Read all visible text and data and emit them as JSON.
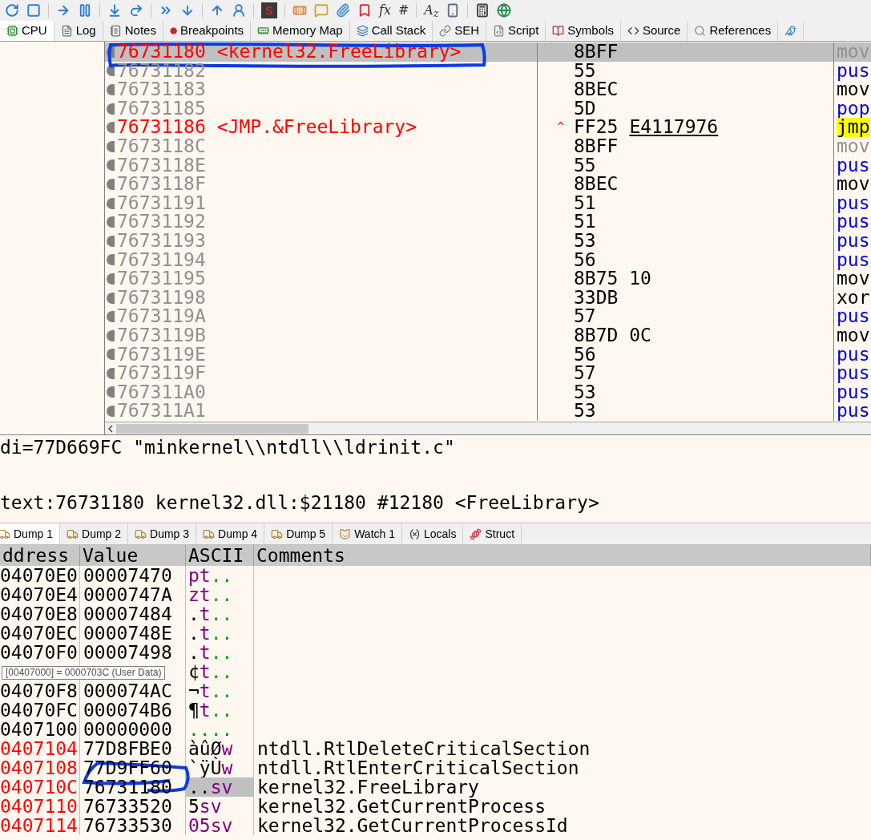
{
  "toolbar": [
    {
      "kind": "icon"
    },
    {
      "kind": "icon"
    },
    {
      "kind": "separator"
    },
    {
      "kind": "icon"
    },
    {
      "kind": "icon"
    },
    {
      "kind": "separator"
    },
    {
      "kind": "icon"
    },
    {
      "kind": "icon"
    },
    {
      "kind": "separator"
    },
    {
      "kind": "icon"
    },
    {
      "kind": "icon"
    },
    {
      "kind": "separator"
    },
    {
      "kind": "icon"
    },
    {
      "kind": "icon"
    },
    {
      "kind": "separator"
    },
    {
      "kind": "badge",
      "text": "S"
    },
    {
      "kind": "separator"
    },
    {
      "kind": "icon"
    },
    {
      "kind": "icon"
    },
    {
      "kind": "icon"
    },
    {
      "kind": "icon"
    },
    {
      "kind": "text",
      "text": "fx"
    },
    {
      "kind": "text",
      "text": "#"
    },
    {
      "kind": "separator"
    },
    {
      "kind": "text",
      "text": "A$_{z}$"
    },
    {
      "kind": "icon"
    },
    {
      "kind": "separator"
    },
    {
      "kind": "icon"
    },
    {
      "kind": "icon"
    }
  ],
  "tabs": [
    {
      "label": "CPU",
      "selected": true
    },
    {
      "label": "Log",
      "selected": false
    },
    {
      "label": "Notes",
      "selected": false
    },
    {
      "label": "Breakpoints",
      "selected": false
    },
    {
      "label": "Memory Map",
      "selected": false
    },
    {
      "label": "Call Stack",
      "selected": false
    },
    {
      "label": "SEH",
      "selected": false
    },
    {
      "label": "Script",
      "selected": false
    },
    {
      "label": "Symbols",
      "selected": false
    },
    {
      "label": "Source",
      "selected": false
    },
    {
      "label": "References",
      "selected": false
    },
    {
      "selected": false
    }
  ],
  "disassembly": {
    "rows": [
      {
        "address": "76731180",
        "label": "<kernel32.FreeLibrary>",
        "kind": "label",
        "selected": true,
        "bytes": "8BFF",
        "mnemonic": {
          "text": "mov",
          "kind": "nop"
        }
      },
      {
        "address": "76731182",
        "kind": "plain",
        "selected": false,
        "bytes": "55",
        "mnemonic": {
          "text": "pus",
          "kind": "stack"
        }
      },
      {
        "address": "76731183",
        "kind": "plain",
        "selected": false,
        "bytes": "8BEC",
        "mnemonic": {
          "text": "mov",
          "kind": "normal"
        }
      },
      {
        "address": "76731185",
        "kind": "plain",
        "selected": false,
        "bytes": "5D",
        "mnemonic": {
          "text": "pop",
          "kind": "stack"
        }
      },
      {
        "address": "76731186",
        "label": "<JMP.&FreeLibrary>",
        "kind": "label",
        "selected": false,
        "jump_mark": "^",
        "bytes": "FF25",
        "target": "E4117976",
        "mnemonic": {
          "text": "jmp",
          "kind": "jump"
        }
      },
      {
        "address": "7673118C",
        "kind": "plain",
        "selected": false,
        "bytes": "8BFF",
        "mnemonic": {
          "text": "mov",
          "kind": "nop"
        }
      },
      {
        "address": "7673118E",
        "kind": "plain",
        "selected": false,
        "bytes": "55",
        "mnemonic": {
          "text": "pus",
          "kind": "stack"
        }
      },
      {
        "address": "7673118F",
        "kind": "plain",
        "selected": false,
        "bytes": "8BEC",
        "mnemonic": {
          "text": "mov",
          "kind": "normal"
        }
      },
      {
        "address": "76731191",
        "kind": "plain",
        "selected": false,
        "bytes": "51",
        "mnemonic": {
          "text": "pus",
          "kind": "stack"
        }
      },
      {
        "address": "76731192",
        "kind": "plain",
        "selected": false,
        "bytes": "51",
        "mnemonic": {
          "text": "pus",
          "kind": "stack"
        }
      },
      {
        "address": "76731193",
        "kind": "plain",
        "selected": false,
        "bytes": "53",
        "mnemonic": {
          "text": "pus",
          "kind": "stack"
        }
      },
      {
        "address": "76731194",
        "kind": "plain",
        "selected": false,
        "bytes": "56",
        "mnemonic": {
          "text": "pus",
          "kind": "stack"
        }
      },
      {
        "address": "76731195",
        "kind": "plain",
        "selected": false,
        "bytes": "8B75 10",
        "mnemonic": {
          "text": "mov",
          "kind": "normal"
        }
      },
      {
        "address": "76731198",
        "kind": "plain",
        "selected": false,
        "bytes": "33DB",
        "mnemonic": {
          "text": "xor",
          "kind": "normal"
        }
      },
      {
        "address": "7673119A",
        "kind": "plain",
        "selected": false,
        "bytes": "57",
        "mnemonic": {
          "text": "pus",
          "kind": "stack"
        }
      },
      {
        "address": "7673119B",
        "kind": "plain",
        "selected": false,
        "bytes": "8B7D 0C",
        "mnemonic": {
          "text": "mov",
          "kind": "normal"
        }
      },
      {
        "address": "7673119E",
        "kind": "plain",
        "selected": false,
        "bytes": "56",
        "mnemonic": {
          "text": "pus",
          "kind": "stack"
        }
      },
      {
        "address": "7673119F",
        "kind": "plain",
        "selected": false,
        "bytes": "57",
        "mnemonic": {
          "text": "pus",
          "kind": "stack"
        }
      },
      {
        "address": "767311A0",
        "kind": "plain",
        "selected": false,
        "bytes": "53",
        "mnemonic": {
          "text": "pus",
          "kind": "stack"
        }
      },
      {
        "address": "767311A1",
        "kind": "plain",
        "selected": false,
        "bytes": "53",
        "mnemonic": {
          "text": "pus",
          "kind": "stack"
        }
      }
    ]
  },
  "info": [
    "di=77D669FC \"minkernel\\\\ntdll\\\\ldrinit.c\"",
    "text:76731180 kernel32.dll:$21180 #12180 <FreeLibrary>"
  ],
  "dump_tabs": [
    {
      "label": "Dump 1",
      "selected": true
    },
    {
      "label": "Dump 2",
      "selected": false
    },
    {
      "label": "Dump 3",
      "selected": false
    },
    {
      "label": "Dump 4",
      "selected": false
    },
    {
      "label": "Dump 5",
      "selected": false
    },
    {
      "label": "Watch 1",
      "selected": false
    },
    {
      "label": "Locals",
      "selected": false
    },
    {
      "label": "Struct",
      "selected": false
    }
  ],
  "dump": {
    "columns": [
      "ddress",
      "Value",
      "ASCII",
      "Comments"
    ],
    "rows": [
      {
        "address": "04070E0",
        "kind": "plain",
        "selected": false,
        "value": "00007470",
        "ascii": [
          {
            "text": "pt",
            "kind": "letter"
          },
          {
            "text": "..",
            "kind": "dot"
          }
        ]
      },
      {
        "address": "04070E4",
        "kind": "plain",
        "selected": false,
        "value": "0000747A",
        "ascii": [
          {
            "text": "zt",
            "kind": "letter"
          },
          {
            "text": "..",
            "kind": "dot"
          }
        ]
      },
      {
        "address": "04070E8",
        "kind": "plain",
        "selected": false,
        "value": "00007484",
        "ascii": [
          {
            "text": ".",
            "kind": "plain"
          },
          {
            "text": "t",
            "kind": "letter"
          },
          {
            "text": "..",
            "kind": "dot"
          }
        ]
      },
      {
        "address": "04070EC",
        "kind": "plain",
        "selected": false,
        "value": "0000748E",
        "ascii": [
          {
            "text": ".",
            "kind": "plain"
          },
          {
            "text": "t",
            "kind": "letter"
          },
          {
            "text": "..",
            "kind": "dot"
          }
        ]
      },
      {
        "address": "04070F0",
        "kind": "plain",
        "selected": false,
        "value": "00007498",
        "ascii": [
          {
            "text": ".",
            "kind": "plain"
          },
          {
            "text": "t",
            "kind": "letter"
          },
          {
            "text": "..",
            "kind": "dot"
          }
        ]
      },
      {
        "selected": false,
        "ascii": [
          {
            "text": "¢",
            "kind": "plain"
          },
          {
            "text": "t",
            "kind": "letter"
          },
          {
            "text": "..",
            "kind": "dot"
          }
        ]
      },
      {
        "address": "04070F8",
        "kind": "plain",
        "selected": false,
        "value": "000074AC",
        "ascii": [
          {
            "text": "¬",
            "kind": "plain"
          },
          {
            "text": "t",
            "kind": "letter"
          },
          {
            "text": "..",
            "kind": "dot"
          }
        ]
      },
      {
        "address": "04070FC",
        "kind": "plain",
        "selected": false,
        "value": "000074B6",
        "ascii": [
          {
            "text": "¶",
            "kind": "plain"
          },
          {
            "text": "t",
            "kind": "letter"
          },
          {
            "text": "..",
            "kind": "dot"
          }
        ]
      },
      {
        "address": "0407100",
        "kind": "plain",
        "selected": false,
        "value": "00000000",
        "ascii": [
          {
            "text": "....",
            "kind": "dot"
          }
        ]
      },
      {
        "address": "0407104",
        "kind": "marked",
        "selected": false,
        "value": "77D8FBE0",
        "ascii": [
          {
            "text": "àûØ",
            "kind": "plain"
          },
          {
            "text": "w",
            "kind": "letter"
          }
        ],
        "comment": "ntdll.RtlDeleteCriticalSection"
      },
      {
        "address": "0407108",
        "kind": "marked",
        "selected": false,
        "value": "77D9FF60",
        "ascii": [
          {
            "text": "`ÿÙ",
            "kind": "plain"
          },
          {
            "text": "w",
            "kind": "letter"
          }
        ],
        "comment": "ntdll.RtlEnterCriticalSection"
      },
      {
        "address": "040710C",
        "kind": "marked",
        "selected": true,
        "value": "76731180",
        "ascii": [
          {
            "text": "..",
            "kind": "plain"
          },
          {
            "text": "sv",
            "kind": "letter"
          }
        ],
        "comment": "kernel32.FreeLibrary"
      },
      {
        "address": "0407110",
        "kind": "marked",
        "selected": false,
        "value": "76733520",
        "ascii": [
          {
            "text": " 5",
            "kind": "plain"
          },
          {
            "text": "sv",
            "kind": "letter"
          }
        ],
        "comment": "kernel32.GetCurrentProcess"
      },
      {
        "address": "0407114",
        "kind": "marked",
        "selected": false,
        "value": "76733530",
        "ascii": [
          {
            "text": "05sv",
            "kind": "letter"
          }
        ],
        "comment": "kernel32.GetCurrentProcessId"
      }
    ]
  },
  "tooltip": "[00407000] = 0000703C (User Data)"
}
